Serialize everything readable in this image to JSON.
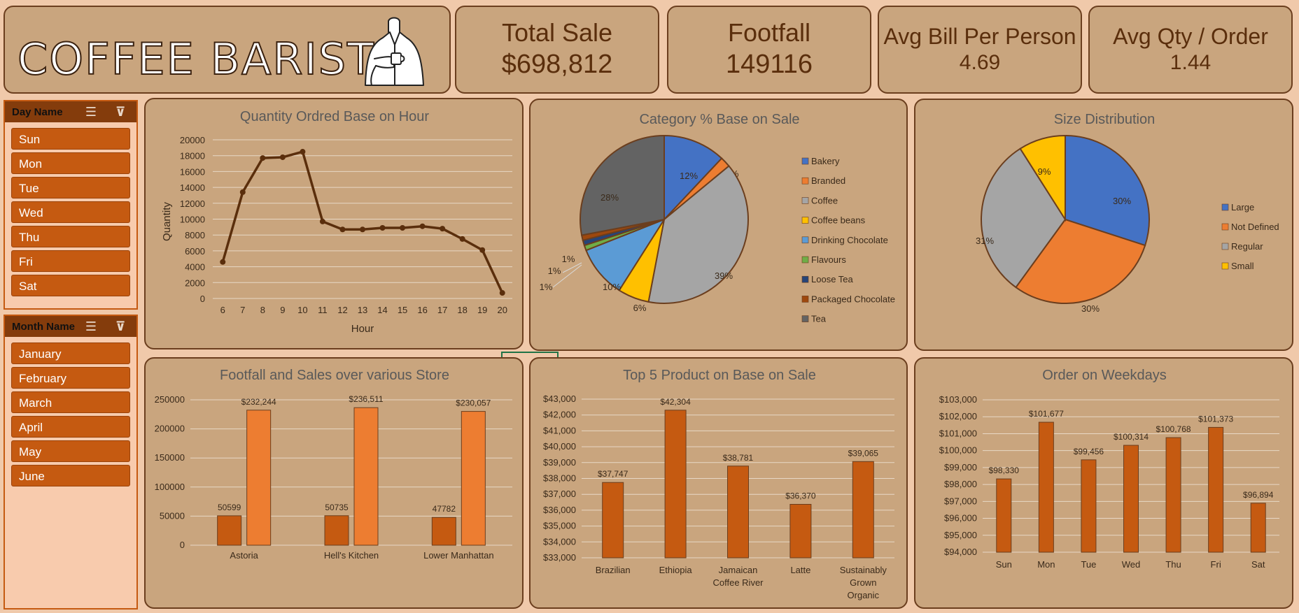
{
  "header": {
    "brand": "COFFEE BARISTA",
    "logo_icon": "barista-icon"
  },
  "kpis": [
    {
      "label": "Total Sale",
      "value": "$698,812"
    },
    {
      "label": "Footfall",
      "value": "149116"
    },
    {
      "label": "Avg Bill Per Person",
      "value": "4.69"
    },
    {
      "label": "Avg Qty / Order",
      "value": "1.44"
    }
  ],
  "slicers": {
    "day": {
      "title": "Day Name",
      "items": [
        "Sun",
        "Mon",
        "Tue",
        "Wed",
        "Thu",
        "Fri",
        "Sat"
      ]
    },
    "month": {
      "title": "Month Name",
      "items": [
        "January",
        "February",
        "March",
        "April",
        "May",
        "June"
      ]
    }
  },
  "colors": {
    "background": "#F0C9AA",
    "panel": "#C9A57E",
    "border": "#6B3E1E",
    "accent": "#C55A11",
    "orange": "#ED7D31",
    "line": "#5A2E0C"
  },
  "chart_data": [
    {
      "id": "hourly",
      "type": "line",
      "title": "Quantity Ordred Base on Hour",
      "xlabel": "Hour",
      "ylabel": "Quantity",
      "x": [
        6,
        7,
        8,
        9,
        10,
        11,
        12,
        13,
        14,
        15,
        16,
        17,
        18,
        19,
        20
      ],
      "values": [
        4600,
        13400,
        17700,
        17800,
        18500,
        9700,
        8700,
        8700,
        8900,
        8900,
        9100,
        8800,
        7500,
        6100,
        700
      ],
      "ylim": [
        0,
        20000
      ],
      "yticks": [
        "0",
        "2000",
        "4000",
        "6000",
        "8000",
        "10000",
        "12000",
        "14000",
        "16000",
        "18000",
        "20000"
      ],
      "grid": true
    },
    {
      "id": "category",
      "type": "pie",
      "title": "Category % Base on Sale",
      "categories": [
        "Bakery",
        "Branded",
        "Coffee",
        "Coffee beans",
        "Drinking Chocolate",
        "Flavours",
        "Loose Tea",
        "Packaged Chocolate",
        "Tea"
      ],
      "values": [
        12,
        2,
        39,
        6,
        10,
        1,
        1,
        1,
        28
      ],
      "labels": [
        "12%",
        "2%",
        "39%",
        "6%",
        "10%",
        "1%",
        "1%",
        "1%",
        "28%"
      ],
      "colors": [
        "#4472C4",
        "#ED7D31",
        "#A5A5A5",
        "#FFC000",
        "#5B9BD5",
        "#70AD47",
        "#264478",
        "#9E480E",
        "#636363"
      ],
      "legend": "right"
    },
    {
      "id": "size",
      "type": "pie",
      "title": "Size Distribution",
      "categories": [
        "Large",
        "Not Defined",
        "Regular",
        "Small"
      ],
      "values": [
        30,
        30,
        31,
        9
      ],
      "labels": [
        "30%",
        "30%",
        "31%",
        "9%"
      ],
      "colors": [
        "#4472C4",
        "#ED7D31",
        "#A5A5A5",
        "#FFC000"
      ],
      "legend": "right"
    },
    {
      "id": "store",
      "type": "bar",
      "title": "Footfall and Sales over various Store",
      "categories": [
        "Astoria",
        "Hell's Kitchen",
        "Lower Manhattan"
      ],
      "series": [
        {
          "values": [
            50599,
            50735,
            47782
          ],
          "labels": [
            "50599",
            "50735",
            "47782"
          ],
          "color": "#C55A11"
        },
        {
          "values": [
            232244,
            236511,
            230057
          ],
          "labels": [
            "$232,244",
            "$236,511",
            "$230,057"
          ],
          "color": "#ED7D31"
        }
      ],
      "ylim": [
        0,
        250000
      ],
      "yticks": [
        "0",
        "50000",
        "100000",
        "150000",
        "200000",
        "250000"
      ]
    },
    {
      "id": "products",
      "type": "bar",
      "title": "Top 5 Product on Base on Sale",
      "categories": [
        [
          "Brazilian"
        ],
        [
          "Ethiopia"
        ],
        [
          "Jamaican",
          "Coffee River"
        ],
        [
          "Latte"
        ],
        [
          "Sustainably",
          "Grown",
          "Organic"
        ]
      ],
      "values": [
        37747,
        42304,
        38781,
        36370,
        39065
      ],
      "labels": [
        "$37,747",
        "$42,304",
        "$38,781",
        "$36,370",
        "$39,065"
      ],
      "ylim": [
        33000,
        43000
      ],
      "yticks": [
        "$33,000",
        "$34,000",
        "$35,000",
        "$36,000",
        "$37,000",
        "$38,000",
        "$39,000",
        "$40,000",
        "$41,000",
        "$42,000",
        "$43,000"
      ]
    },
    {
      "id": "weekdays",
      "type": "bar",
      "title": "Order on Weekdays",
      "categories": [
        "Sun",
        "Mon",
        "Tue",
        "Wed",
        "Thu",
        "Fri",
        "Sat"
      ],
      "values": [
        98330,
        101677,
        99456,
        100314,
        100768,
        101373,
        96894
      ],
      "labels": [
        "$98,330",
        "$101,677",
        "$99,456",
        "$100,314",
        "$100,768",
        "$101,373",
        "$96,894"
      ],
      "ylim": [
        94000,
        103000
      ],
      "yticks": [
        "$94,000",
        "$95,000",
        "$96,000",
        "$97,000",
        "$98,000",
        "$99,000",
        "$100,000",
        "$101,000",
        "$102,000",
        "$103,000"
      ]
    }
  ]
}
